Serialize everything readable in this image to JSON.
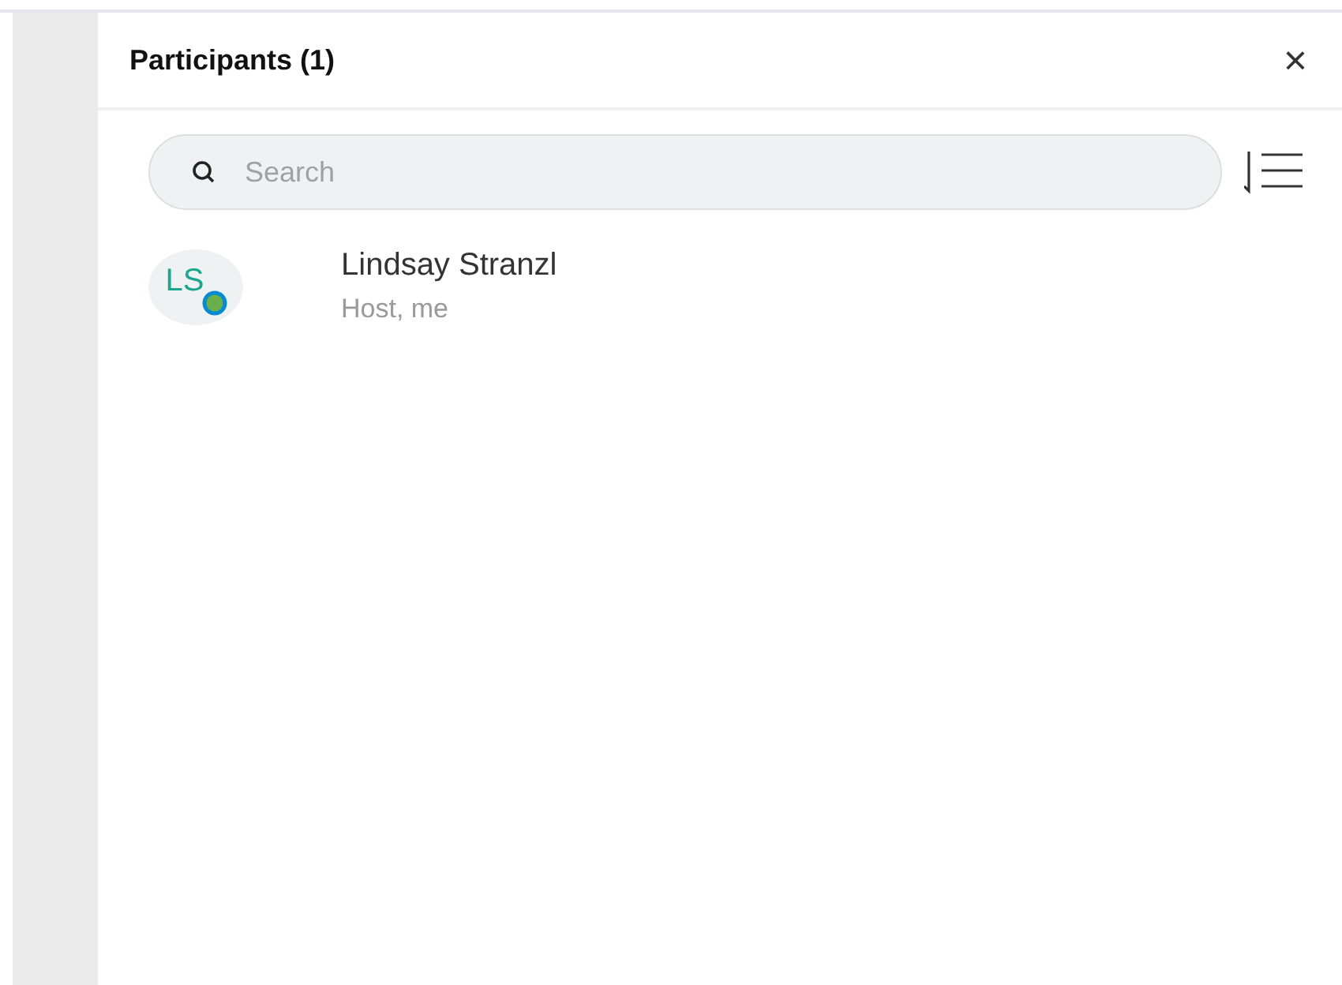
{
  "panel": {
    "title": "Participants (1)",
    "close": "×"
  },
  "search": {
    "placeholder": "Search"
  },
  "participants": [
    {
      "initials": "LS",
      "name": "Lindsay Stranzl",
      "role": "Host, me"
    }
  ]
}
